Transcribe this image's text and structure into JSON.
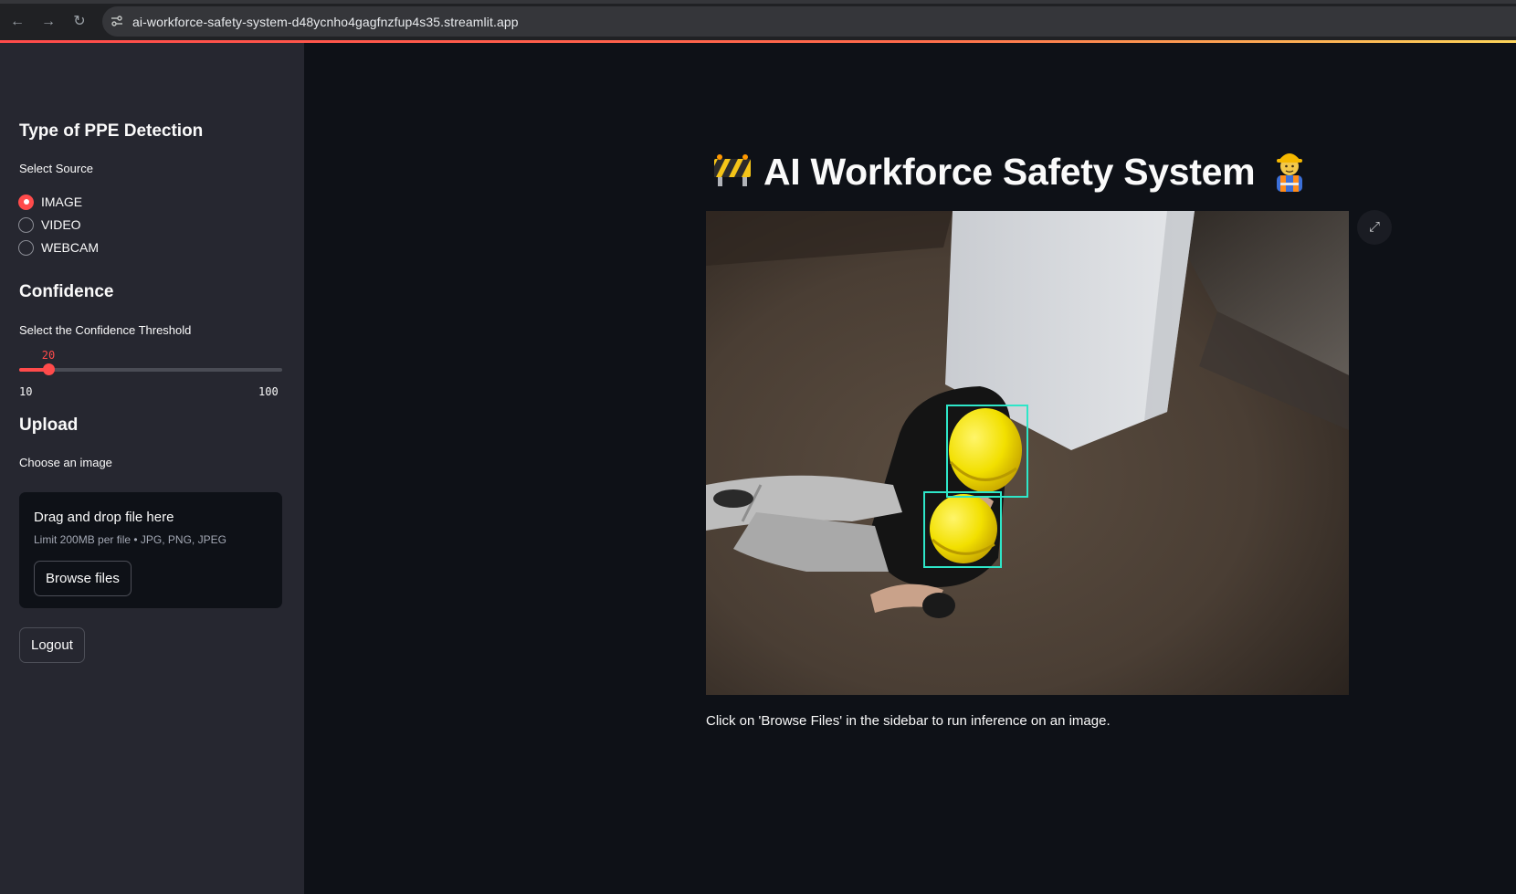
{
  "browser": {
    "url": "ai-workforce-safety-system-d48ycnho4gagfnzfup4s35.streamlit.app"
  },
  "sidebar": {
    "detection_heading": "Type of PPE Detection",
    "source_label": "Select Source",
    "sources": [
      {
        "label": "IMAGE",
        "selected": true
      },
      {
        "label": "VIDEO",
        "selected": false
      },
      {
        "label": "WEBCAM",
        "selected": false
      }
    ],
    "confidence_heading": "Confidence",
    "threshold_label": "Select the Confidence Threshold",
    "slider": {
      "value": "20",
      "min": "10",
      "max": "100"
    },
    "upload_heading": "Upload",
    "choose_label": "Choose an image",
    "dropzone": {
      "title": "Drag and drop file here",
      "subtitle": "Limit 200MB per file • JPG, PNG, JPEG",
      "browse_label": "Browse files"
    },
    "logout_label": "Logout"
  },
  "main": {
    "title": "AI Workforce Safety System",
    "caption": "Click on 'Browse Files' in the sidebar to run inference on an image."
  },
  "colors": {
    "accent": "#ff4b4b",
    "background": "#0e1117",
    "sidebar": "#262730",
    "detection_box": "#2ee6c8"
  }
}
